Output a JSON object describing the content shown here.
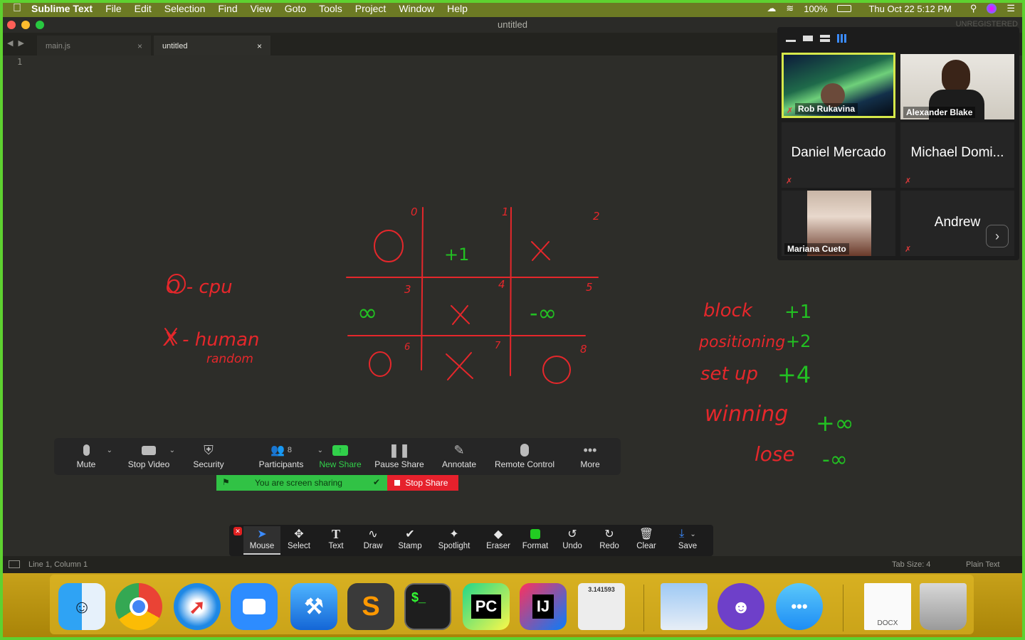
{
  "menubar": {
    "app_name": "Sublime Text",
    "items": [
      "File",
      "Edit",
      "Selection",
      "Find",
      "View",
      "Goto",
      "Tools",
      "Project",
      "Window",
      "Help"
    ],
    "battery": "100%",
    "datetime": "Thu Oct 22  5:12 PM"
  },
  "window": {
    "title": "untitled",
    "unregistered": "UNREGISTERED",
    "tabs": [
      {
        "label": "main.js",
        "close": "×"
      },
      {
        "label": "untitled",
        "close": "×"
      }
    ],
    "line_number": "1"
  },
  "status": {
    "position": "Line 1, Column 1",
    "tab_size": "Tab Size: 4",
    "syntax": "Plain Text"
  },
  "gallery": {
    "participants": [
      {
        "name": "Rob Rukavina",
        "video": true
      },
      {
        "name": "Alexander Blake",
        "video": true
      },
      {
        "name": "Daniel Mercado",
        "video": false
      },
      {
        "name": "Michael Domi...",
        "video": false
      },
      {
        "name": "Mariana Cueto",
        "video": true
      },
      {
        "name": "Andrew",
        "video": false
      }
    ]
  },
  "zoom_toolbar": {
    "mute": "Mute",
    "stop_video": "Stop Video",
    "security": "Security",
    "participants": "Participants",
    "participants_count": "8",
    "new_share": "New Share",
    "pause_share": "Pause Share",
    "annotate": "Annotate",
    "remote_control": "Remote Control",
    "more": "More",
    "sharing_status": "You are screen sharing",
    "stop_share": "Stop Share"
  },
  "annotate_toolbar": {
    "tools": [
      "Mouse",
      "Select",
      "Text",
      "Draw",
      "Stamp",
      "Spotlight",
      "Eraser",
      "Format",
      "Undo",
      "Redo",
      "Clear",
      "Save"
    ],
    "active": "Mouse",
    "format_color": "#22cc22"
  },
  "drawing": {
    "legend_o": "O - cpu",
    "legend_x": "X - human",
    "legend_x_sub": "random",
    "board_indices": [
      "0",
      "1",
      "2",
      "3",
      "4",
      "5",
      "6",
      "7",
      "8"
    ],
    "scores": [
      {
        "label": "block",
        "value": "+1"
      },
      {
        "label": "positioning",
        "value": "+2"
      },
      {
        "label": "set up",
        "value": "+4"
      },
      {
        "label": "winning",
        "value": "+∞"
      },
      {
        "label": "lose",
        "value": "-∞"
      }
    ],
    "cell_plus1": "+1",
    "cell_inf": "∞",
    "cell_neg_inf": "-∞"
  },
  "dock": {
    "apps": [
      "finder-icon",
      "chrome-icon",
      "safari-icon",
      "zoom-icon",
      "xcode-icon",
      "sublime-icon",
      "terminal-icon",
      "pycharm-icon",
      "intellij-icon",
      "calculator-icon",
      "preview-icon",
      "github-desktop-icon",
      "messages-icon",
      "docx-icon",
      "trash-icon"
    ],
    "calculator_text": "3.141593",
    "docx_label": "DOCX"
  },
  "colors": {
    "frame": "#5ed130",
    "annotation_red": "#e5272b",
    "annotation_green": "#22c022"
  }
}
